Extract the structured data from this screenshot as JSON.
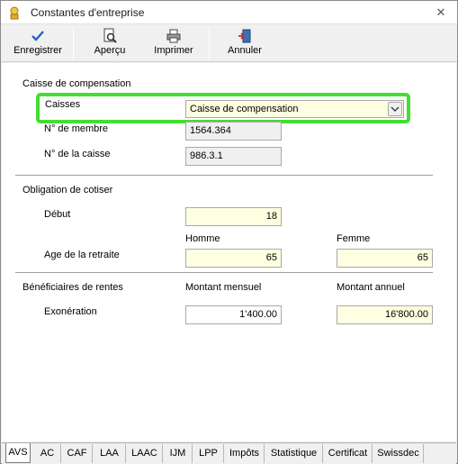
{
  "window": {
    "title": "Constantes d'entreprise",
    "close_glyph": "✕"
  },
  "toolbar": {
    "save": {
      "label": "Enregistrer",
      "icon": "checkmark-icon"
    },
    "preview": {
      "label": "Aperçu",
      "icon": "preview-icon"
    },
    "print": {
      "label": "Imprimer",
      "icon": "printer-icon"
    },
    "cancel": {
      "label": "Annuler",
      "icon": "exit-door-icon"
    }
  },
  "caisse": {
    "section_title": "Caisse de compensation",
    "caisses_label": "Caisses",
    "caisses_value": "Caisse de compensation",
    "membre_label": "N° de membre",
    "membre_value": "1564.364",
    "caisse_no_label": "N° de la caisse",
    "caisse_no_value": "986.3.1"
  },
  "obligation": {
    "section_title": "Obligation de cotiser",
    "debut_label": "Début",
    "debut_value": "18",
    "homme_label": "Homme",
    "femme_label": "Femme",
    "retraite_label": "Age de la retraite",
    "retraite_homme_value": "65",
    "retraite_femme_value": "65"
  },
  "rentes": {
    "section_title": "Bénéficiaires de rentes",
    "mensuel_label": "Montant mensuel",
    "annuel_label": "Montant annuel",
    "exoneration_label": "Exonération",
    "mensuel_value": "1'400.00",
    "annuel_value": "16'800.00"
  },
  "tabs": [
    "AVS",
    "AC",
    "CAF",
    "LAA",
    "LAAC",
    "IJM",
    "LPP",
    "Impôts",
    "Statistique",
    "Certificat",
    "Swissdec"
  ],
  "active_tab": "AVS",
  "colors": {
    "highlight": "#44dd33",
    "field_yellow": "#fefee1"
  }
}
